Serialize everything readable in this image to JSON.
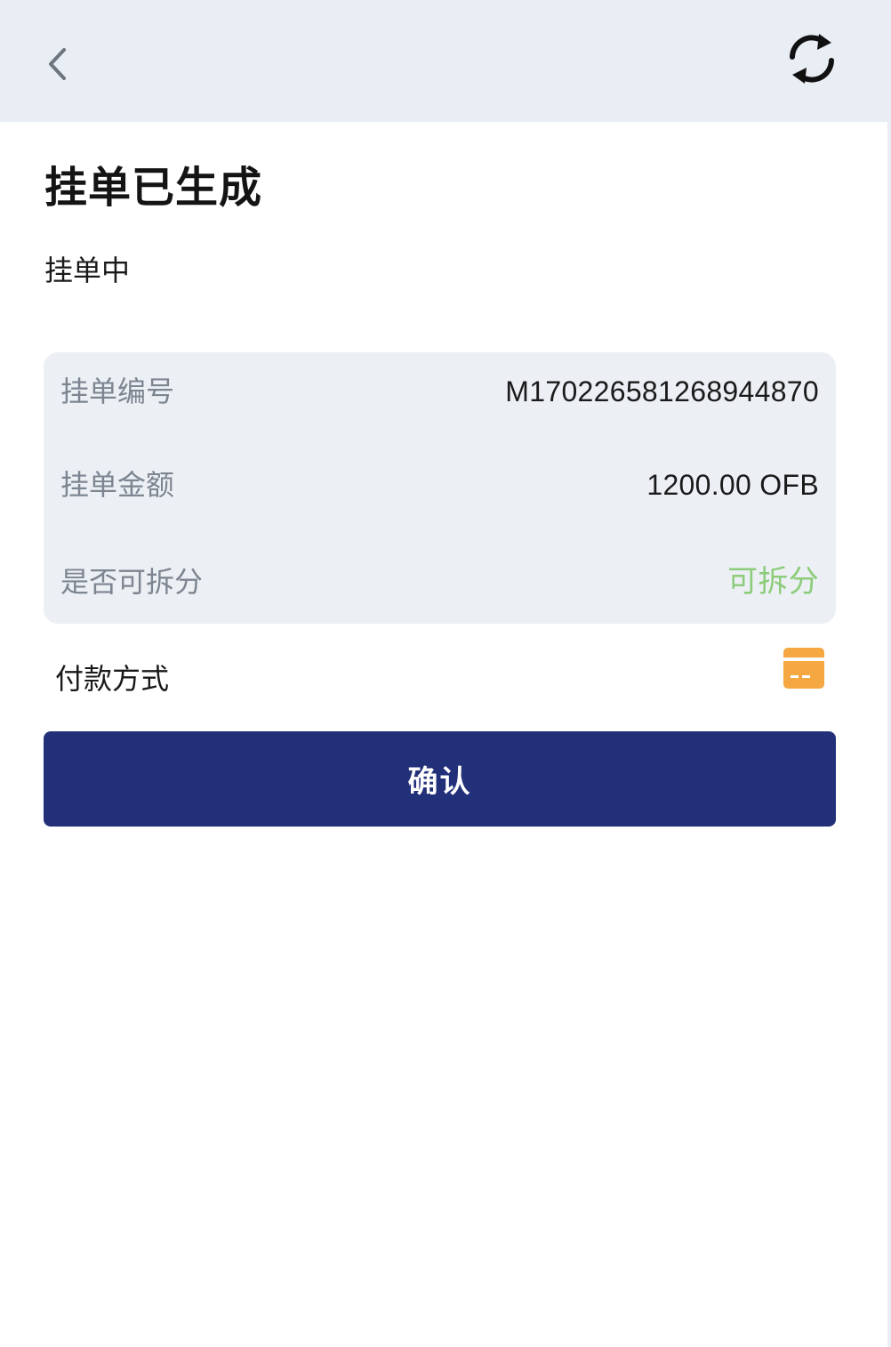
{
  "header": {
    "back_icon": "chevron-left-icon",
    "refresh_icon": "refresh-icon",
    "background": "#e9eef5"
  },
  "page": {
    "title": "挂单已生成",
    "status": "挂单中"
  },
  "order_info": {
    "rows": [
      {
        "label": "挂单编号",
        "value": "M17022658126894487​0"
      },
      {
        "label": "挂单金额",
        "value": "1200.00 OFB"
      },
      {
        "label": "是否可拆分",
        "value": "可拆分"
      }
    ],
    "split_color": "#8ccc7a"
  },
  "payment": {
    "label": "付款方式",
    "icon": "bank-card-icon",
    "icon_color": "#f5a742"
  },
  "actions": {
    "confirm_label": "确认",
    "confirm_color": "#222f79"
  }
}
